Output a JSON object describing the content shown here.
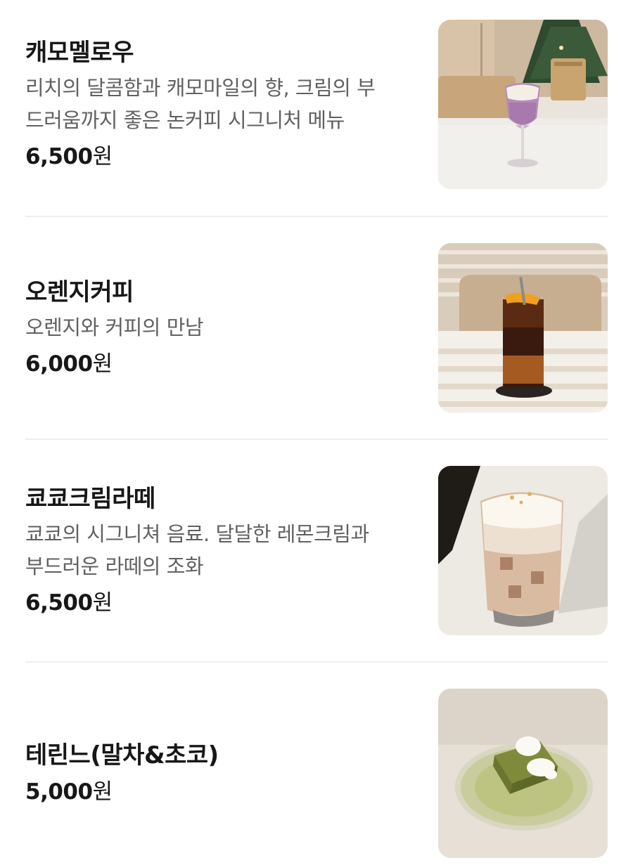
{
  "menu": {
    "items": [
      {
        "name": "캐모멜로우",
        "description_lines": [
          "리치의 달콤함과 캐모마일의 향, 크림의 부",
          "드러움까지 좋은 논커피 시그니처 메뉴"
        ],
        "price_amount": "6,500",
        "price_unit": "원"
      },
      {
        "name": "오렌지커피",
        "description_lines": [
          "오렌지와 커피의 만남"
        ],
        "price_amount": "6,000",
        "price_unit": "원"
      },
      {
        "name": "쿄쿄크림라떼",
        "description_lines": [
          "쿄쿄의 시그니쳐 음료. 달달한 레몬크림과",
          "부드러운 라떼의 조화"
        ],
        "price_amount": "6,500",
        "price_unit": "원"
      },
      {
        "name": "테린느(말차&초코)",
        "description_lines": [],
        "price_amount": "5,000",
        "price_unit": "원"
      }
    ]
  }
}
